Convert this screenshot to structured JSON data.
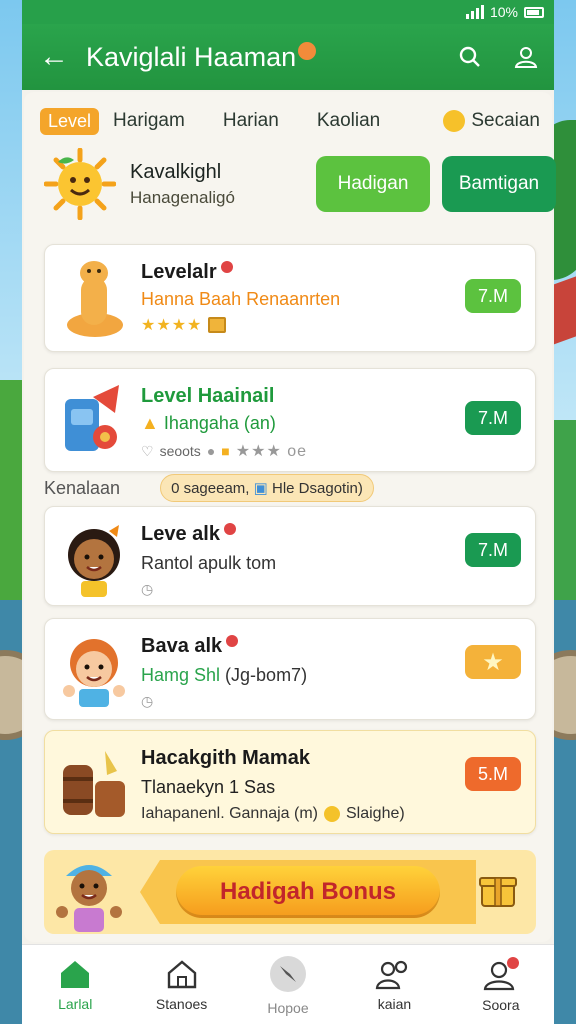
{
  "status_bar": {
    "battery": "10%"
  },
  "header": {
    "title": "Kaviglali Haaman"
  },
  "tabs": {
    "level": "Level",
    "items": [
      "Harigam",
      "Harian",
      "Kaolian"
    ],
    "secondary": "Secaian"
  },
  "hero": {
    "name": "Kavalkighl",
    "subtitle": "Hanagenaligó",
    "button_light": "Hadigan",
    "button_dark": "Bamtigan"
  },
  "cards": [
    {
      "title": "Levelalr",
      "subtitle": "Hanna Baah Renaanrten",
      "subtitle_color": "#f08a16",
      "pill": "7.M",
      "pill_color": "#5cc23f",
      "stars": "★★★★"
    },
    {
      "title": "Level Haainail",
      "subtitle": "Ihangaha (an)",
      "subtitle_color": "#1f9a3c",
      "meta": "seoots",
      "meta2": "★★★ oe",
      "pill": "7.M",
      "pill_color": "#1a9a52"
    },
    {
      "title": "Leve alk",
      "subtitle": "Rantol apulk tom",
      "subtitle_color": "#333333",
      "pill": "7.M",
      "pill_color": "#1a9a52"
    },
    {
      "title": "Bava alk",
      "subtitle": "Hamg Shl",
      "subtitle_extra": "(Jg-bom7)",
      "subtitle_color": "#2aa44c",
      "pill_color": "#f4b23a"
    },
    {
      "title": "Hacakgith Mamak",
      "subtitle": "Tlanaekyn 1 Sas",
      "meta": "Iahapanenl. Gannaja (m)",
      "meta2": "Slaighe)",
      "subtitle_color": "#222222",
      "pill": "5.M",
      "pill_color": "#ee6a2c"
    }
  ],
  "section": {
    "label": "Kenalaan",
    "chip": "0 sageeam,",
    "chip2": "Hle Dsagotin)"
  },
  "bonus": {
    "label": "Hadigah Bonus"
  },
  "nav": [
    {
      "label": "Larlal",
      "icon": "home-icon"
    },
    {
      "label": "Stanoes",
      "icon": "house-outline-icon"
    },
    {
      "label": "Hopoe",
      "icon": "compass-icon"
    },
    {
      "label": "kaian",
      "icon": "users-icon"
    },
    {
      "label": "Soora",
      "icon": "profile-icon"
    }
  ],
  "colors": {
    "brand_green": "#2aa44c",
    "accent_orange": "#f4a52a",
    "bonus_red": "#c2262b"
  }
}
